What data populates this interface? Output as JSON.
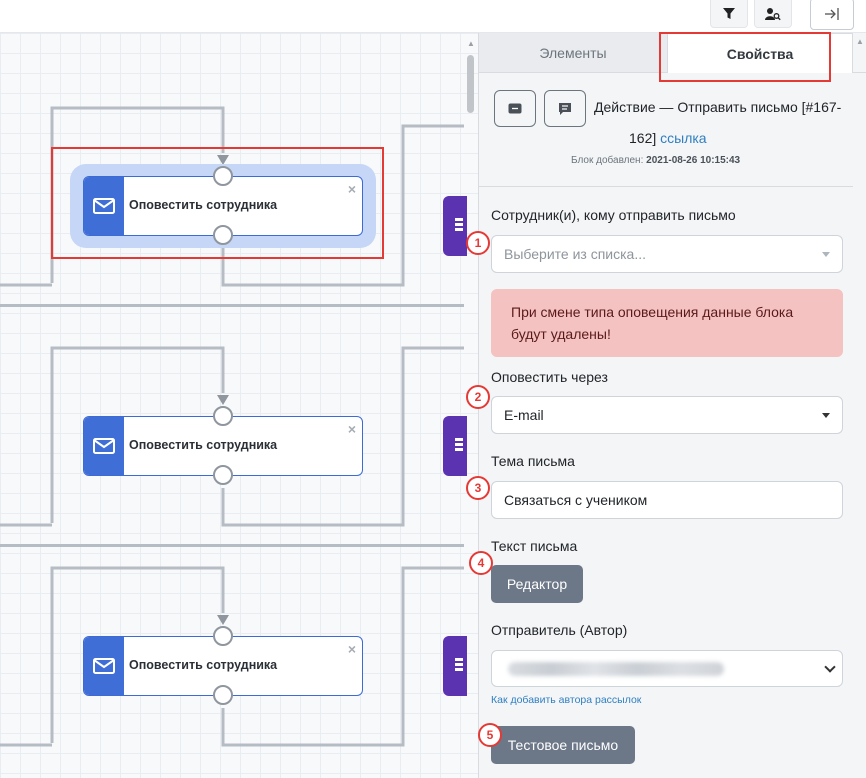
{
  "toolbar": {
    "buttons": [
      {
        "icon": "filter-icon"
      },
      {
        "icon": "user-search-icon"
      },
      {
        "icon": "collapse-panel-icon"
      }
    ]
  },
  "canvas": {
    "nodes": [
      {
        "label": "Оповестить сотрудника",
        "close": "×",
        "selected": true
      },
      {
        "label": "Оповестить сотрудника",
        "close": "×",
        "selected": false
      },
      {
        "label": "Оповестить сотрудника",
        "close": "×",
        "selected": false
      }
    ]
  },
  "panel": {
    "tabs": [
      {
        "label": "Элементы",
        "active": false
      },
      {
        "label": "Свойства",
        "active": true
      }
    ],
    "header": {
      "title_line1": "Действие — Отправить письмо [#167-",
      "title_line2": "162]",
      "link": "ссылка",
      "added_label": "Блок добавлен:",
      "added_value": "2021-08-26 10:15:43"
    },
    "fields": {
      "employee_label": "Сотрудник(и), кому отправить письмо",
      "employee_placeholder": "Выберите из списка...",
      "alert": "При смене типа оповещения данные блока будут удалены!",
      "notify_label": "Оповестить через",
      "notify_value": "E-mail",
      "subject_label": "Тема письма",
      "subject_value": "Связаться с учеником",
      "body_label": "Текст письма",
      "editor_button": "Редактор",
      "sender_label": "Отправитель (Автор)",
      "sender_help": "Как добавить автора рассылок",
      "test_button": "Тестовое письмо"
    },
    "markers": [
      "1",
      "2",
      "3",
      "4",
      "5"
    ]
  },
  "colors": {
    "accent": "#3f6fd6",
    "purple": "#5b32b0",
    "highlight": "#e53935",
    "alert_bg": "#f5c2c2",
    "button_grey": "#6c7787"
  }
}
